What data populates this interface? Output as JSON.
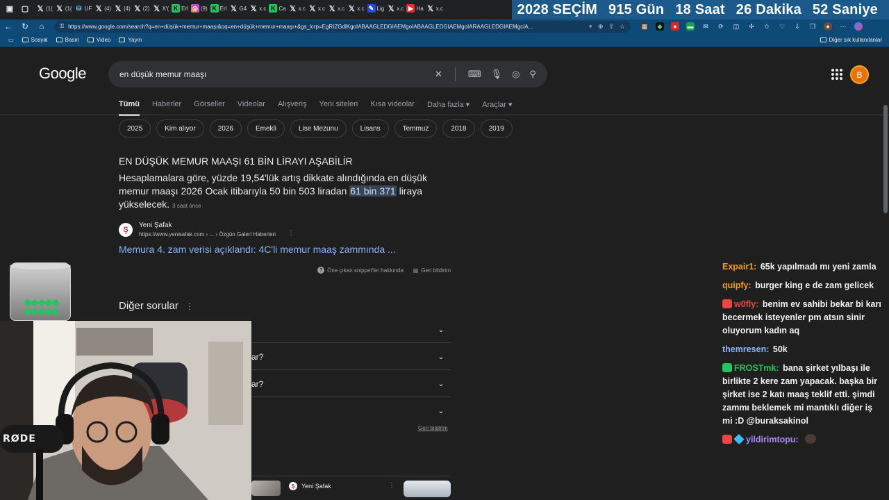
{
  "browser": {
    "tabs": [
      {
        "icon": "x-icon",
        "label": "(1("
      },
      {
        "icon": "x-icon",
        "label": "(1("
      },
      {
        "icon": "db-icon",
        "label": "UF"
      },
      {
        "icon": "x-icon",
        "label": "(4)"
      },
      {
        "icon": "x-icon",
        "label": "(4)"
      },
      {
        "icon": "x-icon",
        "label": "(2)"
      },
      {
        "icon": "x-icon",
        "label": "X'("
      },
      {
        "icon": "g-icon",
        "label": "Erl"
      },
      {
        "icon": "instagram-icon",
        "label": "(9)"
      },
      {
        "icon": "g-icon",
        "label": "Erl"
      },
      {
        "icon": "x-icon",
        "label": "G4"
      },
      {
        "icon": "x-icon",
        "label": "x.c"
      },
      {
        "icon": "g-icon",
        "label": "Ca"
      },
      {
        "icon": "x-icon",
        "label": "x.c"
      },
      {
        "icon": "x-icon",
        "label": "x.c"
      },
      {
        "icon": "x-icon",
        "label": "x.c"
      },
      {
        "icon": "x-icon",
        "label": "x.c"
      },
      {
        "icon": "pen-icon",
        "label": "Lig"
      },
      {
        "icon": "x-icon",
        "label": "x.c"
      },
      {
        "icon": "youtube-icon",
        "label": "Ha"
      },
      {
        "icon": "x-icon",
        "label": "x.c"
      }
    ],
    "url": "https://www.google.com/search?q=en+düşük+memur+maaşı&oq=en+düşük+memur+maaşı+&gs_lcrp=EgRIZGdlKgoIABAAGLEDGIAEMgoIABAAGLEDGIAEMgoIARAAGLEDGIAEMgcIA...",
    "bookmarks": [
      "Sosyal",
      "Basın",
      "Video",
      "Yayın"
    ],
    "bookmarks_other": "Diğer sık kullanılanlar"
  },
  "countdown": {
    "title": "2028 SEÇİM",
    "days": "915 Gün",
    "hours": "18 Saat",
    "minutes": "26 Dakika",
    "seconds": "52 Saniye"
  },
  "google": {
    "logo": "Google",
    "query": "en düşük memur maaşı",
    "avatar_letter": "B",
    "tabs": [
      "Tümü",
      "Haberler",
      "Görseller",
      "Videolar",
      "Alışveriş",
      "Yeni siteleri",
      "Kısa videolar",
      "Daha fazla ▾",
      "Araçlar ▾"
    ],
    "chips": [
      "2025",
      "Kim alıyor",
      "2026",
      "Emekli",
      "Lise Mezunu",
      "Lisans",
      "Temmuz",
      "2018",
      "2019"
    ],
    "snippet": {
      "title": "EN DÜŞÜK MEMUR MAAŞI 61 BİN LİRAYI AŞABİLİR",
      "text_before": "Hesaplamalara göre, yüzde 19,54'lük artış dikkate alındığında en düşük memur maaşı 2026 Ocak itibarıyla 50 bin 503 liradan ",
      "highlight": "61 bin 371",
      "text_after": " liraya yükselecek.",
      "ago": "3 saat önce",
      "source_name": "Yeni Şafak",
      "source_url": "https://www.yenisafak.com › ... › Özgün Galeri Haberleri",
      "link": "Memura 4. zam verisi açıklandı: 4C'li memur maaş zammında ...",
      "about": "Öne çıkan snippet'ler hakkında",
      "feedback": "Geri bildirim"
    },
    "paa": {
      "title": "Diğer sorular",
      "items": [
        "",
        "ar?",
        "ar?",
        ""
      ],
      "feedback": "Geri bildirim"
    },
    "bottom_result": {
      "source": "Yeni Şafak"
    }
  },
  "overlay": {
    "mic_brand": "RØDE"
  },
  "chat": [
    {
      "user": "Expair1:",
      "color": "#f59e0b",
      "text": "65k yapılmadı mı yeni zamla",
      "badge": ""
    },
    {
      "user": "quipfy:",
      "color": "#f59e0b",
      "text": "burger king e de zam gelicek",
      "badge": ""
    },
    {
      "user": "w0fly:",
      "color": "#ef4444",
      "text": "benim ev sahibi bekar bi karı becermek isteyenler pm atsın sinir oluyorum kadın aq",
      "badge": "red"
    },
    {
      "user": "themresen:",
      "color": "#8ab4f8",
      "text": "50k",
      "badge": ""
    },
    {
      "user": "FROSTmk:",
      "color": "#22c55e",
      "text": "bana şirket yılbaşı ile birlikte 2 kere zam yapacak. başka bir şirket ise 2 katı maaş teklif etti. şimdi zammı beklemek mi mantıklı diğer iş mi :D @buraksakinol",
      "badge": "green"
    },
    {
      "user": "yildirimtopu:",
      "color": "#a78bfa",
      "text": "",
      "badge": "red"
    }
  ]
}
